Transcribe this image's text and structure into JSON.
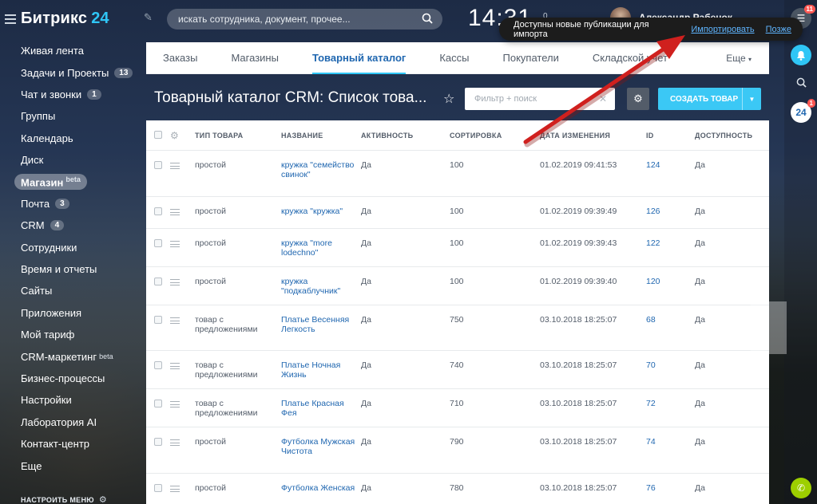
{
  "brand": {
    "name": "Битрикс",
    "number": "24"
  },
  "sidebar": {
    "items": [
      {
        "label": "Живая лента",
        "counter": "",
        "sup": ""
      },
      {
        "label": "Задачи и Проекты",
        "counter": "13",
        "sup": ""
      },
      {
        "label": "Чат и звонки",
        "counter": "1",
        "sup": ""
      },
      {
        "label": "Группы",
        "counter": "",
        "sup": ""
      },
      {
        "label": "Календарь",
        "counter": "",
        "sup": ""
      },
      {
        "label": "Диск",
        "counter": "",
        "sup": ""
      },
      {
        "label": "Магазин",
        "counter": "",
        "sup": "beta"
      },
      {
        "label": "Почта",
        "counter": "3",
        "sup": ""
      },
      {
        "label": "CRM",
        "counter": "4",
        "sup": ""
      },
      {
        "label": "Сотрудники",
        "counter": "",
        "sup": ""
      },
      {
        "label": "Время и отчеты",
        "counter": "",
        "sup": ""
      },
      {
        "label": "Сайты",
        "counter": "",
        "sup": ""
      },
      {
        "label": "Приложения",
        "counter": "",
        "sup": ""
      },
      {
        "label": "Мой тариф",
        "counter": "",
        "sup": ""
      },
      {
        "label": "CRM-маркетинг",
        "counter": "",
        "sup": "beta"
      },
      {
        "label": "Бизнес-процессы",
        "counter": "",
        "sup": ""
      },
      {
        "label": "Настройки",
        "counter": "",
        "sup": ""
      },
      {
        "label": "Лаборатория AI",
        "counter": "",
        "sup": ""
      },
      {
        "label": "Контакт-центр",
        "counter": "",
        "sup": ""
      },
      {
        "label": "Еще",
        "counter": "",
        "sup": ""
      }
    ],
    "footer": "НАСТРОИТЬ МЕНЮ"
  },
  "header": {
    "search_placeholder": "искать сотрудника, документ, прочее...",
    "clock": "14:31",
    "mini_count": "0",
    "user_name": "Александр Рабенок"
  },
  "popup": {
    "text": "Доступны новые публикации для импорта",
    "import_link": "Импортировать",
    "later_link": "Позже"
  },
  "rail": {
    "notifications_badge": "11",
    "b24_badge": "1",
    "b24_label": "24"
  },
  "tabs": [
    {
      "label": "Заказы"
    },
    {
      "label": "Магазины"
    },
    {
      "label": "Товарный каталог"
    },
    {
      "label": "Кассы"
    },
    {
      "label": "Покупатели"
    },
    {
      "label": "Складской учет"
    }
  ],
  "tabs_more": "Еще",
  "toolbar": {
    "title": "Товарный каталог CRM: Список това...",
    "filter_placeholder": "Фильтр + поиск",
    "create_label": "СОЗДАТЬ ТОВАР"
  },
  "grid": {
    "columns": [
      "ТИП ТОВАРА",
      "НАЗВАНИЕ",
      "АКТИВНОСТЬ",
      "СОРТИРОВКА",
      "ДАТА ИЗМЕНЕНИЯ",
      "ID",
      "ДОСТУПНОСТЬ"
    ],
    "rows": [
      {
        "type": "простой",
        "name": "кружка \"семейство свинок\"",
        "active": "Да",
        "sort": "100",
        "date": "01.02.2019 09:41:53",
        "id": "124",
        "avail": "Да"
      },
      {
        "type": "простой",
        "name": "кружка \"кружка\"",
        "active": "Да",
        "sort": "100",
        "date": "01.02.2019 09:39:49",
        "id": "126",
        "avail": "Да"
      },
      {
        "type": "простой",
        "name": "кружка \"more lodechno\"",
        "active": "Да",
        "sort": "100",
        "date": "01.02.2019 09:39:43",
        "id": "122",
        "avail": "Да"
      },
      {
        "type": "простой",
        "name": "кружка \"подкаблучник\"",
        "active": "Да",
        "sort": "100",
        "date": "01.02.2019 09:39:40",
        "id": "120",
        "avail": "Да"
      },
      {
        "type": "товар с предложениями",
        "name": "Платье Весенняя Легкость",
        "active": "Да",
        "sort": "750",
        "date": "03.10.2018 18:25:07",
        "id": "68",
        "avail": "Да"
      },
      {
        "type": "товар с предложениями",
        "name": "Платье Ночная Жизнь",
        "active": "Да",
        "sort": "740",
        "date": "03.10.2018 18:25:07",
        "id": "70",
        "avail": "Да"
      },
      {
        "type": "товар с предложениями",
        "name": "Платье Красная Фея",
        "active": "Да",
        "sort": "710",
        "date": "03.10.2018 18:25:07",
        "id": "72",
        "avail": "Да"
      },
      {
        "type": "простой",
        "name": "Футболка Мужская Чистота",
        "active": "Да",
        "sort": "790",
        "date": "03.10.2018 18:25:07",
        "id": "74",
        "avail": "Да"
      },
      {
        "type": "простой",
        "name": "Футболка Женская",
        "active": "Да",
        "sort": "780",
        "date": "03.10.2018 18:25:07",
        "id": "76",
        "avail": "Да"
      }
    ]
  },
  "colors": {
    "accent": "#2fc6f6",
    "link": "#2067b0",
    "create_button": "#3bc8f5",
    "popup_bg": "#1c1c1c",
    "annotation_arrow": "#d0201e",
    "badge": "#ff5752"
  }
}
